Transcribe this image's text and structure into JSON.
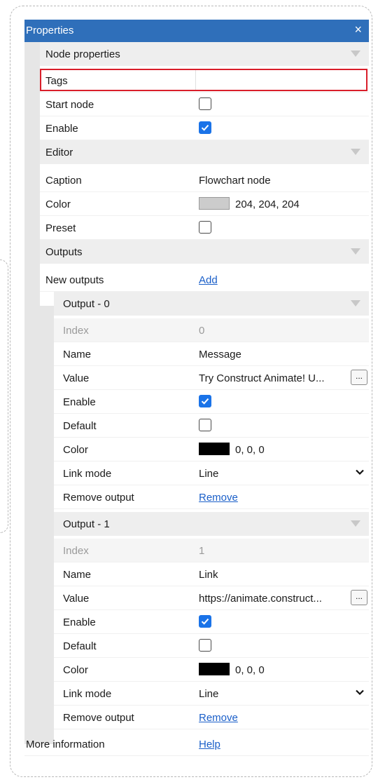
{
  "window": {
    "title": "Properties",
    "close_glyph": "×"
  },
  "node_properties": {
    "header": "Node properties",
    "tags_label": "Tags",
    "tags_value": "",
    "start_node_label": "Start node",
    "start_node_checked": false,
    "enable_label": "Enable",
    "enable_checked": true
  },
  "editor": {
    "header": "Editor",
    "caption_label": "Caption",
    "caption_value": "Flowchart node",
    "color_label": "Color",
    "color_value": "204, 204, 204",
    "color_hex": "#cccccc",
    "preset_label": "Preset",
    "preset_checked": false
  },
  "outputs": {
    "header": "Outputs",
    "new_outputs_label": "New outputs",
    "add_link": "Add",
    "items": [
      {
        "header": "Output - 0",
        "index_label": "Index",
        "index_value": "0",
        "name_label": "Name",
        "name_value": "Message",
        "value_label": "Value",
        "value_value": "Try Construct Animate! U...",
        "button_label": "...",
        "enable_label": "Enable",
        "enable_checked": true,
        "default_label": "Default",
        "default_checked": false,
        "color_label": "Color",
        "color_value": "0, 0, 0",
        "color_hex": "#000000",
        "link_mode_label": "Link mode",
        "link_mode_value": "Line",
        "remove_label": "Remove output",
        "remove_link": "Remove"
      },
      {
        "header": "Output - 1",
        "index_label": "Index",
        "index_value": "1",
        "name_label": "Name",
        "name_value": "Link",
        "value_label": "Value",
        "value_value": "https://animate.construct...",
        "button_label": "...",
        "enable_label": "Enable",
        "enable_checked": true,
        "default_label": "Default",
        "default_checked": false,
        "color_label": "Color",
        "color_value": "0, 0, 0",
        "color_hex": "#000000",
        "link_mode_label": "Link mode",
        "link_mode_value": "Line",
        "remove_label": "Remove output",
        "remove_link": "Remove"
      }
    ]
  },
  "footer": {
    "more_info_label": "More information",
    "help_link": "Help"
  }
}
